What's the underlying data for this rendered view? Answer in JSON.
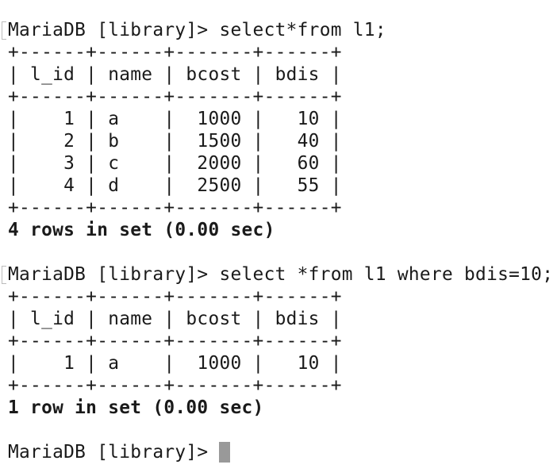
{
  "prompt": "MariaDB [library]> ",
  "queries": [
    {
      "command": "select*from l1;",
      "border": "+------+------+-------+------+",
      "header": "| l_id | name | bcost | bdis |",
      "rows": [
        "|    1 | a    |  1000 |   10 |",
        "|    2 | b    |  1500 |   40 |",
        "|    3 | c    |  2000 |   60 |",
        "|    4 | d    |  2500 |   55 |"
      ],
      "footer": "4 rows in set (0.00 sec)"
    },
    {
      "command": "select *from l1 where bdis=10;",
      "border": "+------+------+-------+------+",
      "header": "| l_id | name | bcost | bdis |",
      "rows": [
        "|    1 | a    |  1000 |   10 |"
      ],
      "footer": "1 row in set (0.00 sec)"
    }
  ],
  "cursor_color": "#999999"
}
